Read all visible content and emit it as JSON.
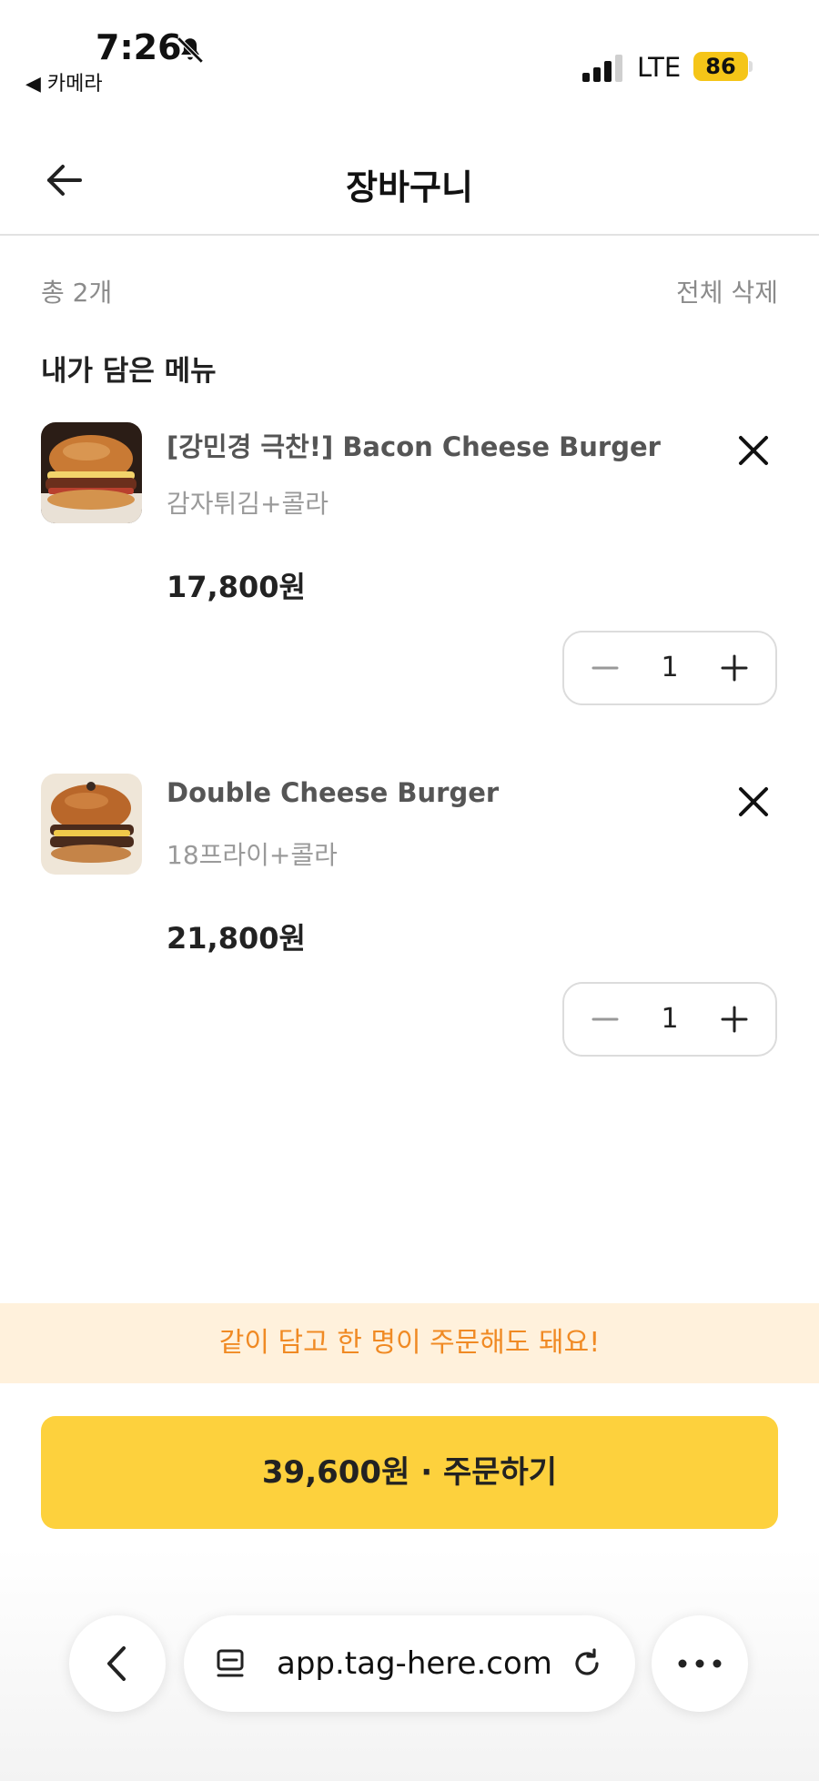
{
  "status_bar": {
    "time": "7:26",
    "back_app": "◀ 카메라",
    "network": "LTE",
    "battery": "86"
  },
  "header": {
    "title": "장바구니"
  },
  "summary": {
    "total_count": "총 2개",
    "delete_all": "전체 삭제"
  },
  "section_title": "내가 담은 메뉴",
  "items": [
    {
      "name": "[강민경 극찬!] Bacon Cheese Burger",
      "option": "감자튀김+콜라",
      "price": "17,800원",
      "quantity": "1"
    },
    {
      "name": "Double Cheese Burger",
      "option": "18프라이+콜라",
      "price": "21,800원",
      "quantity": "1"
    }
  ],
  "banner": "같이 담고 한 명이 주문해도 돼요!",
  "order_button": "39,600원 · 주문하기",
  "browser": {
    "url": "app.tag-here.com"
  },
  "colors": {
    "accent": "#fdd13d",
    "banner_bg": "#fff1dc",
    "banner_text": "#f08a24"
  }
}
